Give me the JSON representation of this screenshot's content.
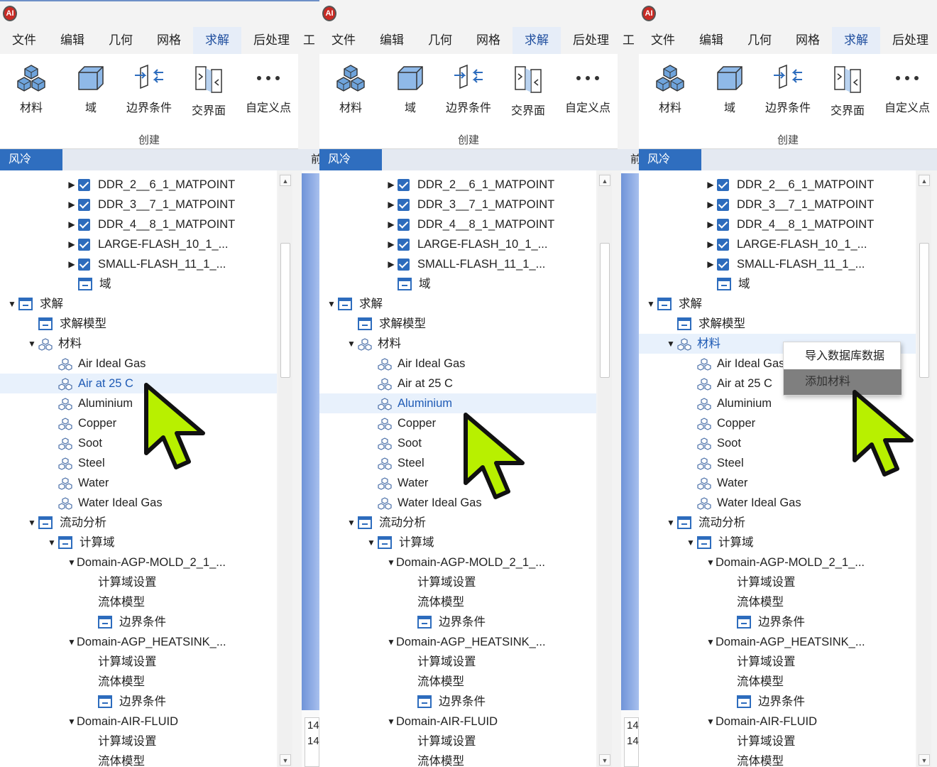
{
  "app": {
    "icon_label": "AI"
  },
  "menus": [
    "文件",
    "编辑",
    "几何",
    "网格",
    "求解",
    "后处理",
    "工"
  ],
  "active_menu": "求解",
  "ribbon": {
    "buttons": [
      {
        "label": "材料",
        "icon": "materials-icon"
      },
      {
        "label": "域",
        "icon": "domain-box-icon"
      },
      {
        "label": "边界条件",
        "icon": "boundary-condition-icon"
      },
      {
        "label": "交界面",
        "icon": "interface-icon"
      },
      {
        "label": "自定义点",
        "icon": "more-dots-icon"
      }
    ],
    "group_label": "创建"
  },
  "tree_panel": {
    "tab_label": "风冷",
    "side_tab_label": "前"
  },
  "tree": [
    {
      "label": "DDR_2__6_1_MATPOINT",
      "type": "check",
      "indent": 3
    },
    {
      "label": "DDR_3__7_1_MATPOINT",
      "type": "check",
      "indent": 3
    },
    {
      "label": "DDR_4__8_1_MATPOINT",
      "type": "check",
      "indent": 3
    },
    {
      "label": "LARGE-FLASH_10_1_...",
      "type": "check",
      "indent": 3
    },
    {
      "label": "SMALL-FLASH_11_1_...",
      "type": "check",
      "indent": 3
    },
    {
      "label": "域",
      "type": "folder",
      "indent": 3
    },
    {
      "label": "求解",
      "type": "folder",
      "indent": 0,
      "expanded": true
    },
    {
      "label": "求解模型",
      "type": "folder",
      "indent": 1
    },
    {
      "label": "材料",
      "type": "mat",
      "indent": 1,
      "expanded": true
    },
    {
      "label": "Air Ideal Gas",
      "type": "mat",
      "indent": 2
    },
    {
      "label": "Air at 25 C",
      "type": "mat",
      "indent": 2
    },
    {
      "label": "Aluminium",
      "type": "mat",
      "indent": 2
    },
    {
      "label": "Copper",
      "type": "mat",
      "indent": 2
    },
    {
      "label": "Soot",
      "type": "mat",
      "indent": 2
    },
    {
      "label": "Steel",
      "type": "mat",
      "indent": 2
    },
    {
      "label": "Water",
      "type": "mat",
      "indent": 2
    },
    {
      "label": "Water Ideal Gas",
      "type": "mat",
      "indent": 2
    },
    {
      "label": "流动分析",
      "type": "folder",
      "indent": 1,
      "expanded": true
    },
    {
      "label": "计算域",
      "type": "folder",
      "indent": 2,
      "expanded": true
    },
    {
      "label": "Domain-AGP-MOLD_2_1_...",
      "type": "plain",
      "indent": 3,
      "expanded": true
    },
    {
      "label": "计算域设置",
      "type": "plain",
      "indent": 4
    },
    {
      "label": "流体模型",
      "type": "plain",
      "indent": 4
    },
    {
      "label": "边界条件",
      "type": "folder",
      "indent": 4
    },
    {
      "label": "Domain-AGP_HEATSINK_...",
      "type": "plain",
      "indent": 3,
      "expanded": true
    },
    {
      "label": "计算域设置",
      "type": "plain",
      "indent": 4
    },
    {
      "label": "流体模型",
      "type": "plain",
      "indent": 4
    },
    {
      "label": "边界条件",
      "type": "folder",
      "indent": 4
    },
    {
      "label": "Domain-AIR-FLUID",
      "type": "plain",
      "indent": 3,
      "expanded": true
    },
    {
      "label": "计算域设置",
      "type": "plain",
      "indent": 4
    },
    {
      "label": "流体模型",
      "type": "plain",
      "indent": 4
    }
  ],
  "frames": [
    {
      "selected_row": 10
    },
    {
      "selected_row": 11
    },
    {
      "selected_row": 8
    }
  ],
  "right_numbers": [
    "14",
    "14"
  ],
  "context_menu": {
    "items": [
      "导入数据库数据",
      "添加材料"
    ],
    "highlighted": "添加材料"
  },
  "colors": {
    "accent": "#2f6ebf",
    "selection": "#e8f1fc",
    "cursor": "#b8f000"
  }
}
